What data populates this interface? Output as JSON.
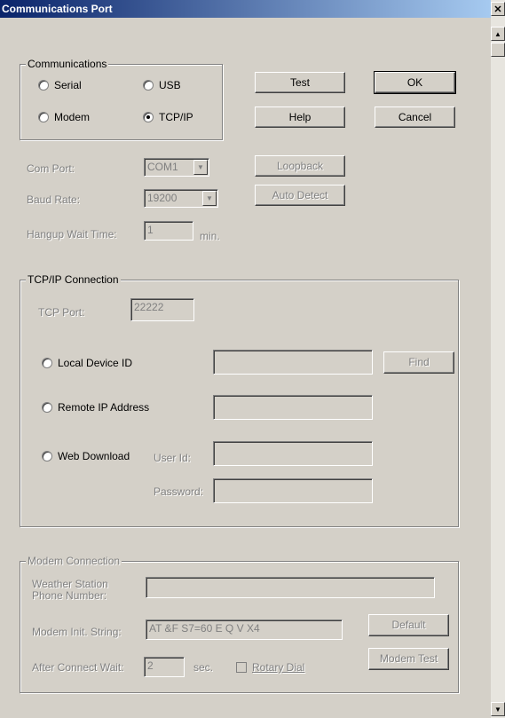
{
  "window": {
    "title": "Communications Port"
  },
  "communications": {
    "group_label": "Communications",
    "options": [
      {
        "label": "Serial",
        "selected": false
      },
      {
        "label": "USB",
        "selected": false
      },
      {
        "label": "Modem",
        "selected": false
      },
      {
        "label": "TCP/IP",
        "selected": true
      }
    ]
  },
  "buttons": {
    "test": "Test",
    "ok": "OK",
    "help": "Help",
    "cancel": "Cancel",
    "loopback": "Loopback",
    "auto_detect": "Auto Detect"
  },
  "serial": {
    "com_port_label": "Com Port:",
    "com_port_value": "COM1",
    "baud_rate_label": "Baud Rate:",
    "baud_rate_value": "19200",
    "hangup_label": "Hangup Wait Time:",
    "hangup_value": "1",
    "hangup_unit": "min."
  },
  "tcpip": {
    "group_label": "TCP/IP Connection",
    "tcp_port_label": "TCP Port:",
    "tcp_port_value": "22222",
    "local_device_label": "Local Device ID",
    "local_device_value": "",
    "find_button": "Find",
    "remote_ip_label": "Remote IP Address",
    "remote_ip_value": "",
    "web_download_label": "Web Download",
    "user_id_label": "User Id:",
    "user_id_value": "",
    "password_label": "Password:",
    "password_value": ""
  },
  "modem": {
    "group_label": "Modem Connection",
    "phone_label_line1": "Weather Station",
    "phone_label_line2": "Phone Number:",
    "phone_value": "",
    "init_string_label": "Modem Init. String:",
    "init_string_value": "AT &F S7=60 E Q V X4",
    "default_button": "Default",
    "modem_test_button": "Modem Test",
    "after_connect_label": "After Connect Wait:",
    "after_connect_value": "2",
    "after_connect_unit": "sec.",
    "rotary_dial_label": "Rotary Dial",
    "rotary_dial_checked": false
  }
}
